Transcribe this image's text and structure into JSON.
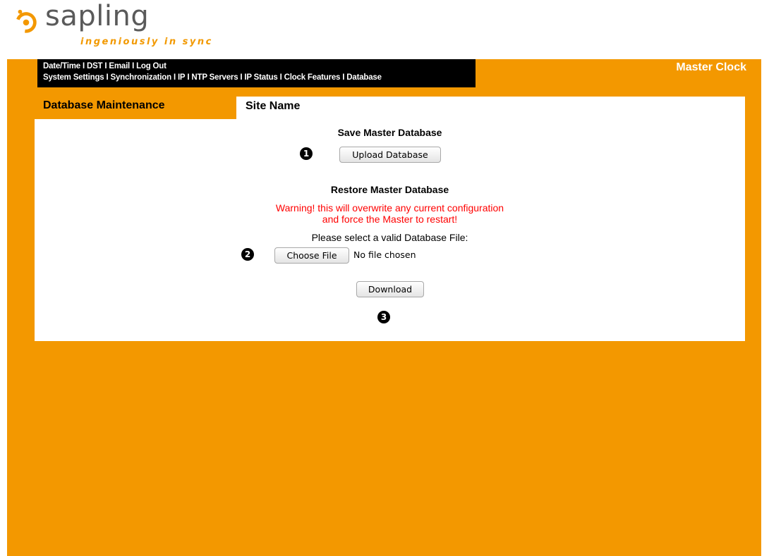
{
  "brand": {
    "wordmark": "sapling",
    "tagline": "ingeniously in sync",
    "accent_color": "#f39800",
    "logo_icon": "sapling-swirl-logo"
  },
  "nav": {
    "row1": [
      "Date/Time",
      "DST",
      "Email",
      "Log Out"
    ],
    "row2": [
      "System Settings",
      "Synchronization",
      "IP",
      "NTP Servers",
      "IP Status",
      "Clock Features",
      "Database"
    ],
    "separator": "I"
  },
  "header": {
    "app_title": "Master Clock",
    "section_title": "Database Maintenance",
    "site_name": "Site Name"
  },
  "save": {
    "heading": "Save Master Database",
    "button_label": "Upload Database"
  },
  "restore": {
    "heading": "Restore Master Database",
    "warning_line1": "Warning! this will overwrite any current configuration",
    "warning_line2": "and force the Master to restart!",
    "select_label": "Please select a valid Database File:",
    "choose_label": "Choose File",
    "file_status": "No file chosen",
    "download_label": "Download"
  },
  "markers": [
    "1",
    "2",
    "3"
  ]
}
